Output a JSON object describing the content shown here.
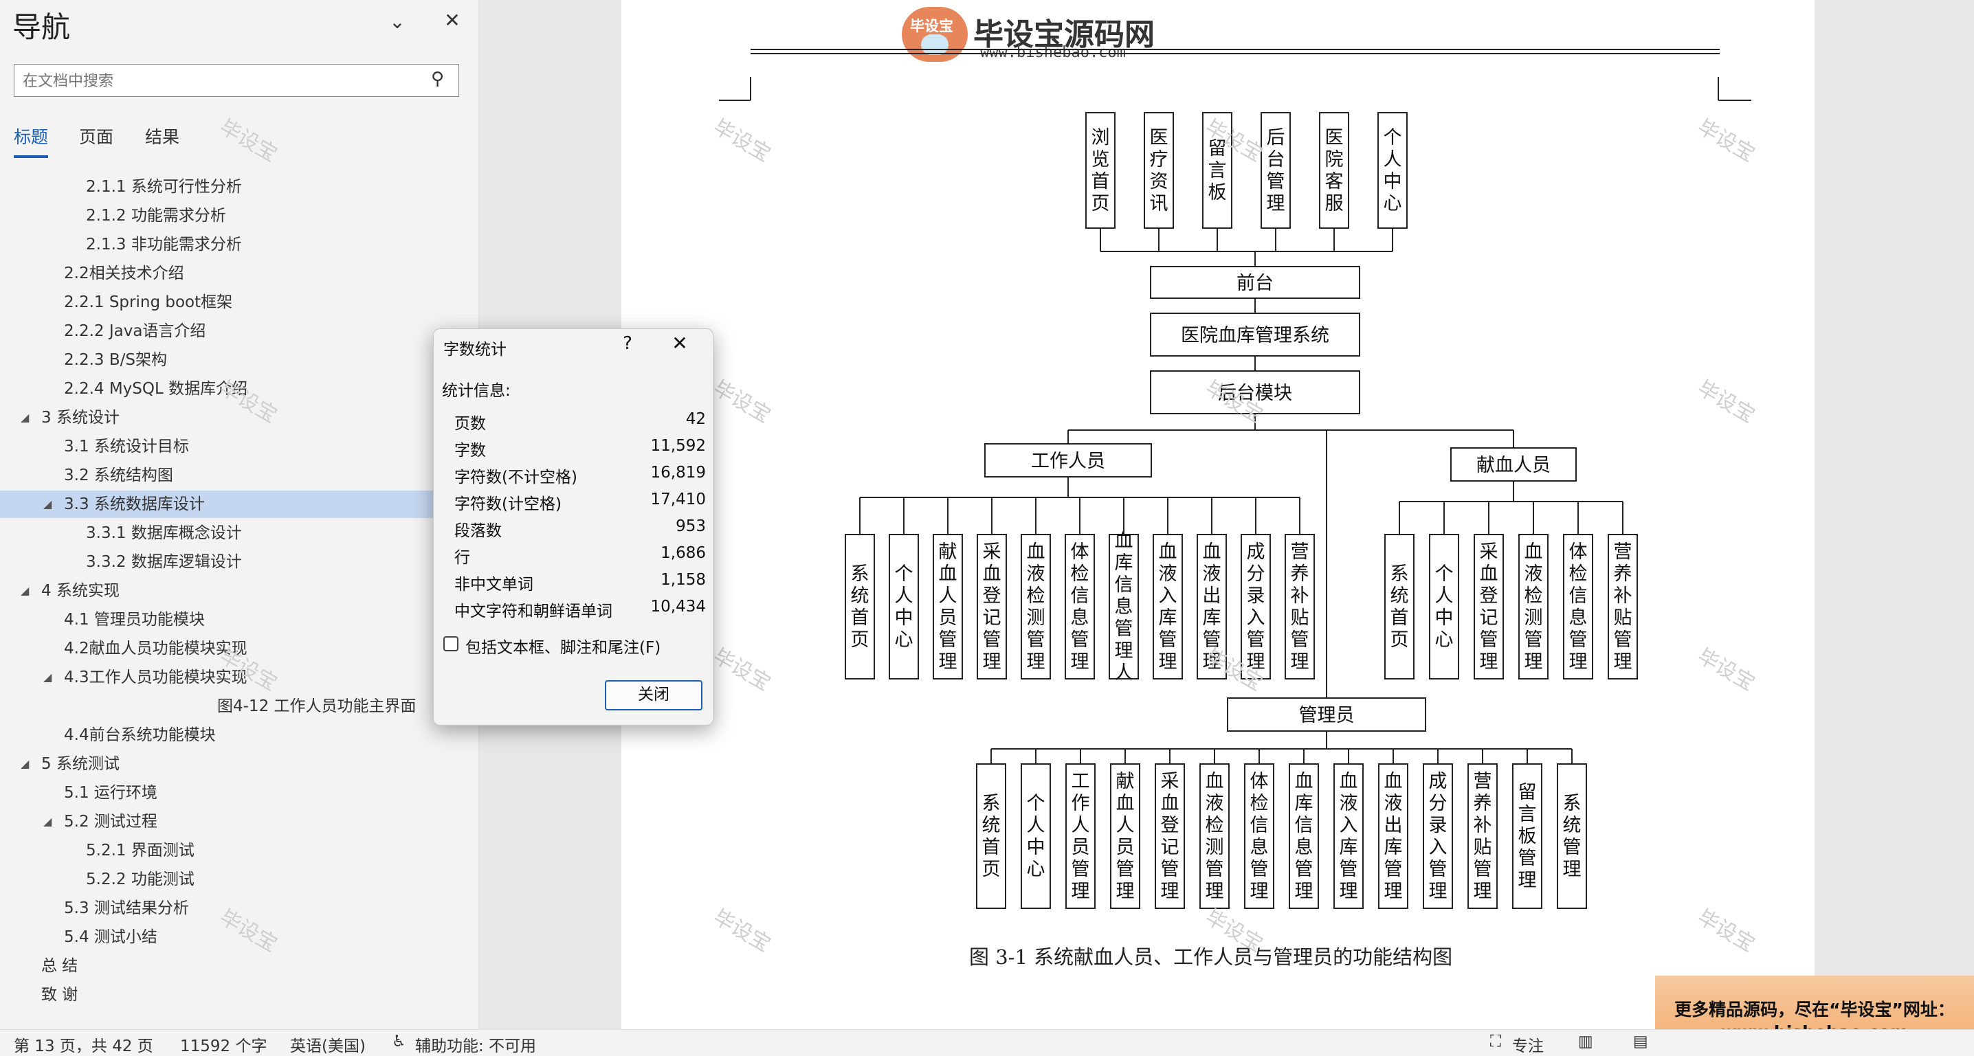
{
  "nav": {
    "title": "导航",
    "search_placeholder": "在文档中搜索",
    "tabs": [
      "标题",
      "页面",
      "结果"
    ],
    "items": [
      {
        "label": "2.1.1 系统可行性分析",
        "level": 3
      },
      {
        "label": "2.1.2 功能需求分析",
        "level": 3
      },
      {
        "label": "2.1.3 非功能需求分析",
        "level": 3
      },
      {
        "label": "2.2相关技术介绍",
        "level": 2
      },
      {
        "label": "2.2.1 Spring boot框架",
        "level": 2
      },
      {
        "label": "2.2.2 Java语言介绍",
        "level": 2
      },
      {
        "label": "2.2.3 B/S架构",
        "level": 2
      },
      {
        "label": "2.2.4 MySQL 数据库介绍",
        "level": 2
      },
      {
        "label": "3 系统设计",
        "level": 1,
        "expandable": true
      },
      {
        "label": "3.1 系统设计目标",
        "level": 2
      },
      {
        "label": "3.2 系统结构图",
        "level": 2
      },
      {
        "label": "3.3 系统数据库设计",
        "level": 2,
        "expandable": true,
        "selected": true
      },
      {
        "label": "3.3.1 数据库概念设计",
        "level": 3
      },
      {
        "label": "3.3.2 数据库逻辑设计",
        "level": 3
      },
      {
        "label": "4 系统实现",
        "level": 1,
        "expandable": true
      },
      {
        "label": "4.1  管理员功能模块",
        "level": 2
      },
      {
        "label": "4.2献血人员功能模块实现",
        "level": 2
      },
      {
        "label": "4.3工作人员功能模块实现",
        "level": 2,
        "expandable": true
      },
      {
        "label": "图4-12 工作人员功能主界面",
        "level": 4
      },
      {
        "label": "4.4前台系统功能模块",
        "level": 2
      },
      {
        "label": "5 系统测试",
        "level": 1,
        "expandable": true
      },
      {
        "label": "5.1 运行环境",
        "level": 2
      },
      {
        "label": "5.2 测试过程",
        "level": 2,
        "expandable": true
      },
      {
        "label": "5.2.1 界面测试",
        "level": 3
      },
      {
        "label": "5.2.2 功能测试",
        "level": 3
      },
      {
        "label": "5.3 测试结果分析",
        "level": 2
      },
      {
        "label": "5.4 测试小结",
        "level": 2
      },
      {
        "label": "总  结",
        "level": 1
      },
      {
        "label": "致  谢",
        "level": 1
      }
    ]
  },
  "dialog": {
    "title": "字数统计",
    "help": "?",
    "section": "统计信息:",
    "stats": [
      {
        "key": "页数",
        "value": "42"
      },
      {
        "key": "字数",
        "value": "11,592"
      },
      {
        "key": "字符数(不计空格)",
        "value": "16,819"
      },
      {
        "key": "字符数(计空格)",
        "value": "17,410"
      },
      {
        "key": "段落数",
        "value": "953"
      },
      {
        "key": "行",
        "value": "1,686"
      },
      {
        "key": "非中文单词",
        "value": "1,158"
      },
      {
        "key": "中文字符和朝鲜语单词",
        "value": "10,434"
      }
    ],
    "checkbox_label": "包括文本框、脚注和尾注(F)",
    "close_label": "关闭"
  },
  "document": {
    "logo_title": "毕设宝源码网",
    "logo_badge": "毕设宝",
    "logo_url": "www.bishebao.com",
    "watermark": "毕设宝",
    "caption": "图 3-1  系统献血人员、工作人员与管理员的功能结构图",
    "diagram": {
      "top_items": [
        "浏览首页",
        "医疗资讯",
        "留言板",
        "后台管理",
        "医院客服",
        "个人中心"
      ],
      "front": "前台",
      "system": "医院血库管理系统",
      "backend": "后台模块",
      "staff": "工作人员",
      "staff_items": [
        "系统首页",
        "个人中心",
        "献血人员管理",
        "采血登记管理",
        "血液检测管理",
        "体检信息管理",
        "血库信息管理人",
        "血液入库管理",
        "血液出库管理",
        "成分录入管理",
        "营养补贴管理"
      ],
      "donor": "献血人员",
      "donor_items": [
        "系统首页",
        "个人中心",
        "采血登记管理",
        "血液检测管理",
        "体检信息管理",
        "营养补贴管理"
      ],
      "admin": "管理员",
      "admin_items": [
        "系统首页",
        "个人中心",
        "工作人员管理",
        "献血人员管理",
        "采血登记管理",
        "血液检测管理",
        "体检信息管理",
        "血库信息管理",
        "血液入库管理",
        "血液出库管理",
        "成分录入管理",
        "营养补贴管理",
        "留言板管理",
        "系统管理"
      ]
    }
  },
  "status": {
    "page": "第 13 页，共 42 页",
    "words": "11592 个字",
    "language": "英语(美国)",
    "accessibility": "辅助功能: 不可用",
    "focus": "专注"
  },
  "ad": {
    "line1": "更多精品源码，尽在“毕设宝”网址：",
    "line2": "www.bishebao.com"
  }
}
